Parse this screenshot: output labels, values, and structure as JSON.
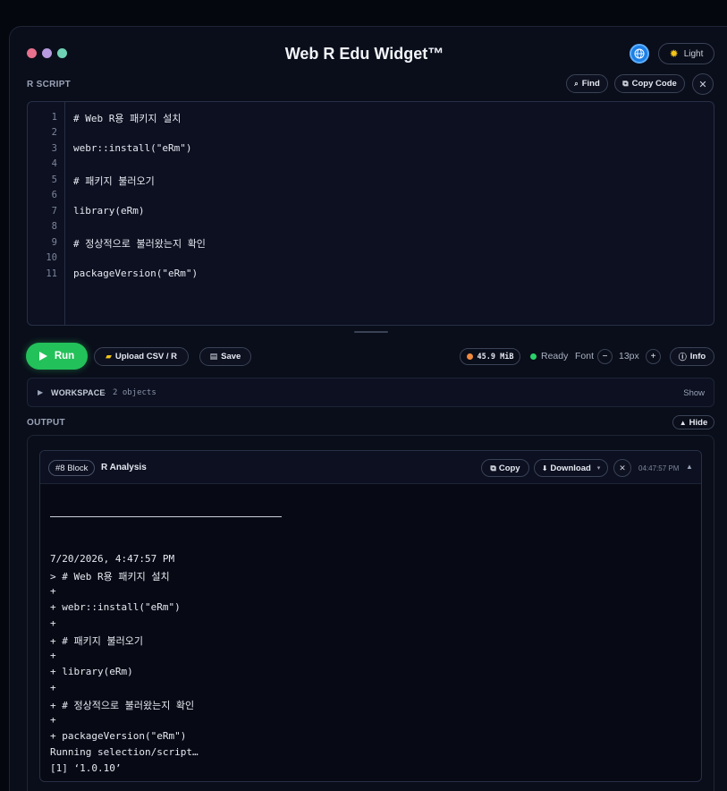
{
  "header": {
    "title": "Web R Edu Widget™",
    "dots": [
      "#e8718e",
      "#b79bde",
      "#6fd2b4"
    ],
    "theme_label": "Light"
  },
  "script_section": {
    "label": "R SCRIPT",
    "find_label": "Find",
    "copy_code_label": "Copy Code",
    "lines": [
      {
        "num": "1",
        "code": "# Web R용 패키지 설치"
      },
      {
        "num": "2",
        "code": ""
      },
      {
        "num": "3",
        "code": "webr::install(\"eRm\")"
      },
      {
        "num": "4",
        "code": ""
      },
      {
        "num": "5",
        "code": "# 패키지 불러오기"
      },
      {
        "num": "6",
        "code": ""
      },
      {
        "num": "7",
        "code": "library(eRm)"
      },
      {
        "num": "8",
        "code": ""
      },
      {
        "num": "9",
        "code": "# 정상적으로 불러왔는지 확인"
      },
      {
        "num": "10",
        "code": ""
      },
      {
        "num": "11",
        "code": "packageVersion(\"eRm\")"
      }
    ]
  },
  "toolbar": {
    "run_label": "Run",
    "upload_label": "Upload CSV / R",
    "save_label": "Save",
    "memory": "45.9 MiB",
    "status": "Ready",
    "font_label": "Font",
    "font_size": "13px",
    "info_label": "Info"
  },
  "workspace": {
    "title": "WORKSPACE",
    "separator": "·",
    "count": "2 objects",
    "toggle_label": "Show"
  },
  "output": {
    "label": "OUTPUT",
    "hide_label": "Hide",
    "block": {
      "id": "#8 Block",
      "title": "R Analysis",
      "copy_label": "Copy",
      "download_label": "Download",
      "time": "04:47:57 PM",
      "lines": [
        "7/20/2026, 4:47:57 PM",
        "> # Web R용 패키지 설치",
        "+ ",
        "+ webr::install(\"eRm\")",
        "+ ",
        "+ # 패키지 불러오기",
        "+ ",
        "+ library(eRm)",
        "+ ",
        "+ # 정상적으로 불러왔는지 확인",
        "+ ",
        "+ packageVersion(\"eRm\")",
        "Running selection/script…",
        "[1] ‘1.0.10’"
      ]
    }
  }
}
